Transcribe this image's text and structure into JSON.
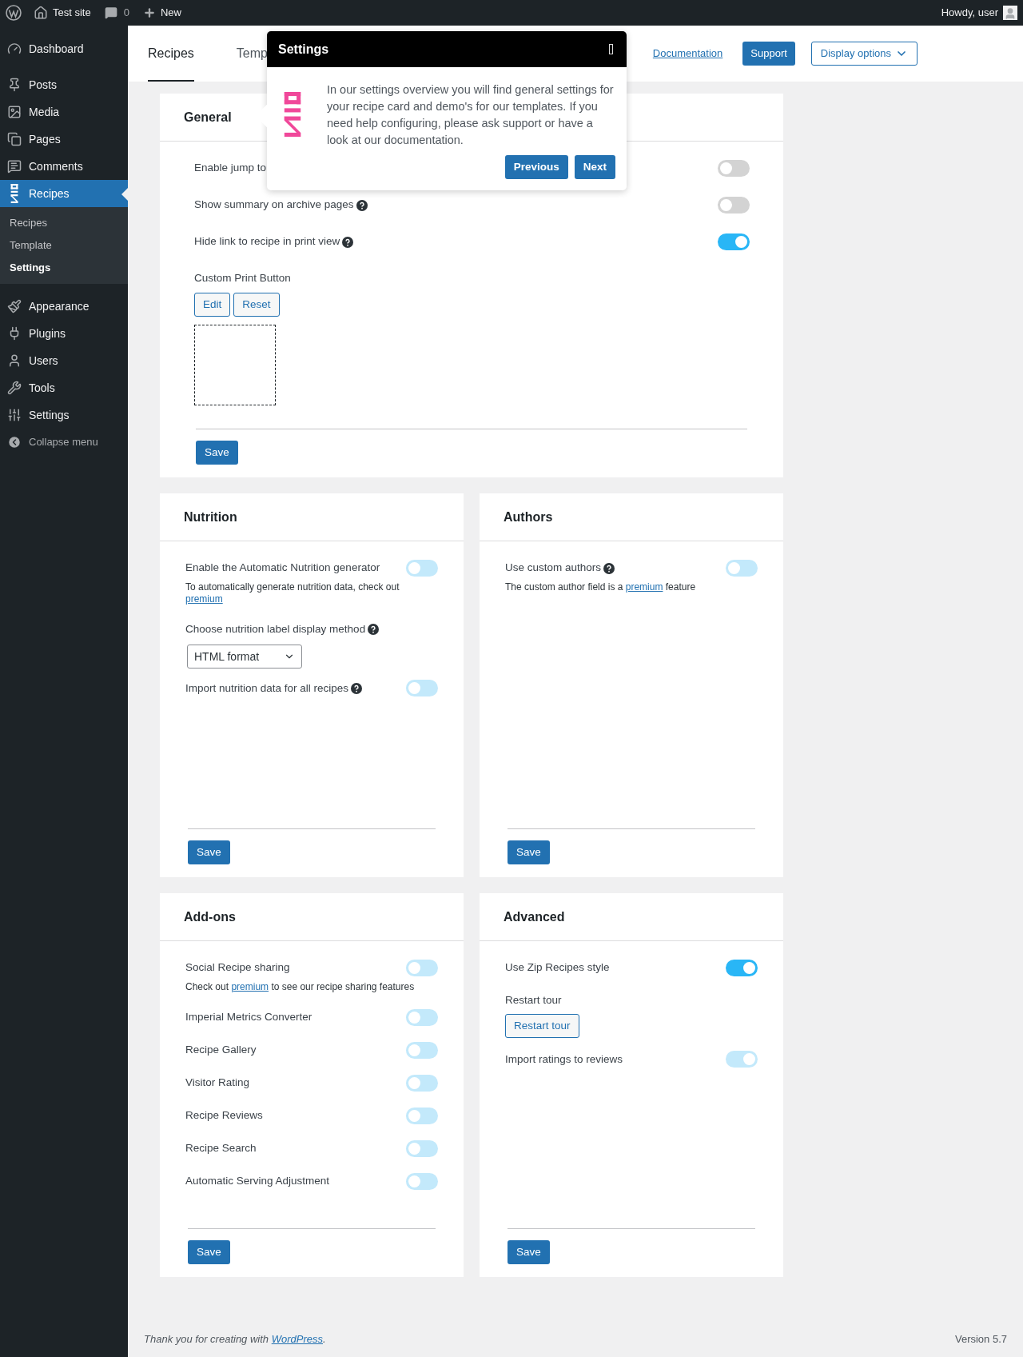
{
  "admin_bar": {
    "site": "Test site",
    "comments": "0",
    "new": "New",
    "greeting": "Howdy, user"
  },
  "sidebar": {
    "items": [
      {
        "label": "Dashboard",
        "selected": false
      },
      {
        "label": "Posts",
        "selected": false
      },
      {
        "label": "Media",
        "selected": false
      },
      {
        "label": "Pages",
        "selected": false
      },
      {
        "label": "Comments",
        "selected": false
      },
      {
        "label": "Recipes",
        "selected": true,
        "children": [
          {
            "label": "Recipes",
            "selected": false
          },
          {
            "label": "Template",
            "selected": false
          },
          {
            "label": "Settings",
            "selected": true
          }
        ]
      },
      {
        "label": "Appearance",
        "selected": false
      },
      {
        "label": "Plugins",
        "selected": false
      },
      {
        "label": "Users",
        "selected": false
      },
      {
        "label": "Tools",
        "selected": false
      },
      {
        "label": "Settings",
        "selected": false
      }
    ],
    "collapse": "Collapse menu"
  },
  "header": {
    "tabs": [
      {
        "label": "Recipes",
        "selected": true
      },
      {
        "label": "Temp",
        "selected": false
      }
    ],
    "documentation": "Documentation",
    "support": "Support",
    "display_options": "Display options"
  },
  "tour": {
    "title": "Settings",
    "text": "In our settings overview you will find general settings for your recipe card and demo's for our templates. If you need help configuring, please ask support or have a look at our documentation.",
    "buttons": [
      "Previous",
      "Next"
    ]
  },
  "cards": [
    {
      "title": "General",
      "save": "Save",
      "items": [
        {
          "kind": "toggle",
          "label": "Enable jump to",
          "help": false,
          "on": false,
          "disabled": false
        },
        {
          "kind": "toggle",
          "label": "Show summary on archive pages",
          "help": true,
          "on": false,
          "disabled": false
        },
        {
          "kind": "toggle",
          "label": "Hide link to recipe in print view",
          "help": true,
          "on": true,
          "disabled": false
        },
        {
          "kind": "print_button",
          "label": "Custom Print Button",
          "buttons": [
            "Edit",
            "Reset"
          ]
        }
      ]
    },
    {
      "title": "Nutrition",
      "save": "Save",
      "items": [
        {
          "kind": "toggle",
          "label": "Enable the Automatic Nutrition generator",
          "help": false,
          "on": false,
          "disabled": true,
          "hint": {
            "before": "To automatically generate nutrition data, check out ",
            "link": "premium"
          }
        },
        {
          "kind": "select",
          "label": "Choose nutrition label display method",
          "help": true,
          "value": "HTML format"
        },
        {
          "kind": "toggle",
          "label": "Import nutrition data for all recipes",
          "help": true,
          "on": false,
          "disabled": true
        }
      ]
    },
    {
      "title": "Authors",
      "save": "Save",
      "items": [
        {
          "kind": "toggle",
          "label": "Use custom authors",
          "help": true,
          "on": false,
          "disabled": true,
          "hint": {
            "before": "The custom author field is a ",
            "link": "premium",
            "after": " feature"
          }
        }
      ]
    },
    {
      "title": "Add-ons",
      "save": "Save",
      "items": [
        {
          "kind": "toggle",
          "label": "Social Recipe sharing",
          "help": false,
          "on": false,
          "disabled": true,
          "hint": {
            "before": "Check out ",
            "link": "premium",
            "after": " to see our recipe sharing features"
          }
        },
        {
          "kind": "toggle",
          "label": "Imperial Metrics Converter",
          "help": false,
          "on": false,
          "disabled": true
        },
        {
          "kind": "toggle",
          "label": "Recipe Gallery",
          "help": false,
          "on": false,
          "disabled": true
        },
        {
          "kind": "toggle",
          "label": "Visitor Rating",
          "help": false,
          "on": false,
          "disabled": true
        },
        {
          "kind": "toggle",
          "label": "Recipe Reviews",
          "help": false,
          "on": false,
          "disabled": true
        },
        {
          "kind": "toggle",
          "label": "Recipe Search",
          "help": false,
          "on": false,
          "disabled": true
        },
        {
          "kind": "toggle",
          "label": "Automatic Serving Adjustment",
          "help": false,
          "on": false,
          "disabled": true
        }
      ]
    },
    {
      "title": "Advanced",
      "save": "Save",
      "items": [
        {
          "kind": "toggle",
          "label": "Use Zip Recipes style",
          "help": false,
          "on": true,
          "disabled": false
        },
        {
          "kind": "button",
          "label": "Restart tour",
          "button": "Restart tour"
        },
        {
          "kind": "toggle",
          "label": "Import ratings to reviews",
          "help": false,
          "on": true,
          "disabled": true
        }
      ]
    }
  ],
  "footer": {
    "before": "Thank you for creating with ",
    "link": "WordPress",
    "after": ".",
    "version": "Version 5.7"
  }
}
